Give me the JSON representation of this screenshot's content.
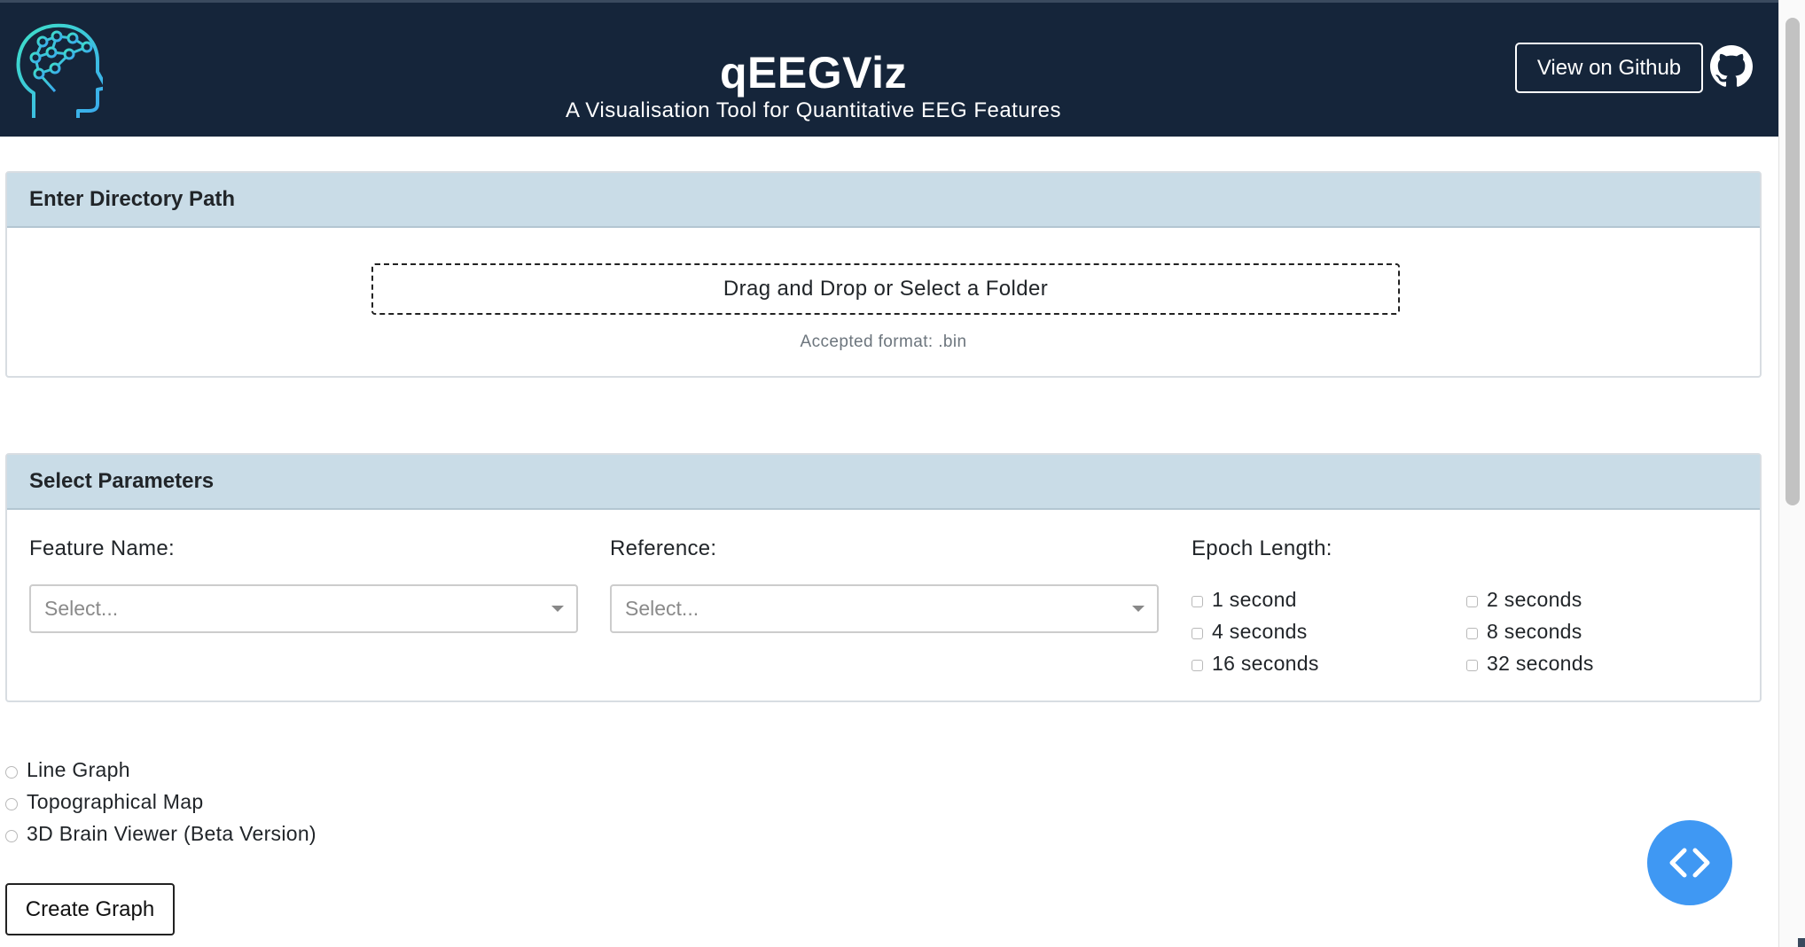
{
  "header": {
    "title": "qEEGViz",
    "subtitle": "A Visualisation Tool for Quantitative EEG Features",
    "github_button": "View on Github",
    "logo_icon": "brain-head-icon",
    "github_icon": "github-icon",
    "background": "#15253a"
  },
  "upload": {
    "card_title": "Enter Directory Path",
    "dropzone_label": "Drag and Drop or Select a Folder",
    "accepted_format": "Accepted format: .bin"
  },
  "parameters": {
    "card_title": "Select Parameters",
    "feature": {
      "label": "Feature Name:",
      "placeholder": "Select..."
    },
    "reference": {
      "label": "Reference:",
      "placeholder": "Select..."
    },
    "epoch": {
      "label": "Epoch Length:",
      "options": [
        "1 second",
        "2 seconds",
        "4 seconds",
        "8 seconds",
        "16 seconds",
        "32 seconds"
      ]
    }
  },
  "graph_types": [
    "Line Graph",
    "Topographical Map",
    "3D Brain Viewer (Beta Version)"
  ],
  "create_button": "Create Graph",
  "fab_icon": "code-icon",
  "accent_color": "#3f98f3"
}
